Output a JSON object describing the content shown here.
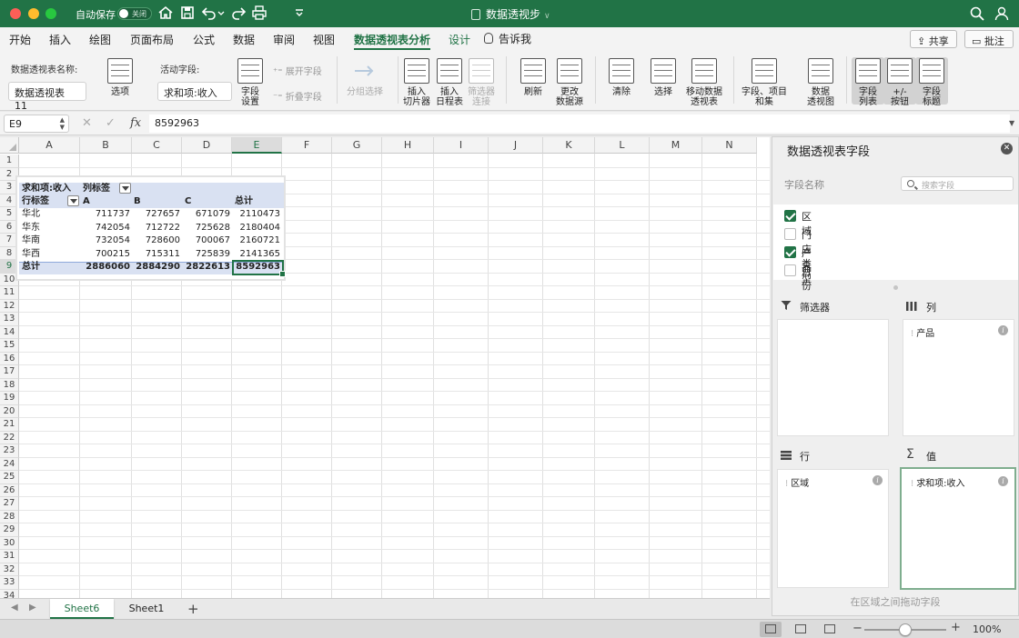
{
  "titlebar": {
    "autosave_label": "自动保存",
    "autosave_state": "关闭",
    "doc_title": "数据透视步",
    "title_chevron": "∨"
  },
  "menu": {
    "tabs": [
      "开始",
      "插入",
      "绘图",
      "页面布局",
      "公式",
      "数据",
      "审阅",
      "视图",
      "数据透视表分析",
      "设计"
    ],
    "active_tab": "数据透视表分析",
    "tell_me": "告诉我",
    "share": "共享",
    "comment": "批注"
  },
  "ribbon": {
    "pivot_name_label": "数据透视表名称:",
    "pivot_name": "数据透视表 11",
    "options": "选项",
    "active_field_label": "活动字段:",
    "active_field": "求和项:收入",
    "field_settings": [
      "字段",
      "设置"
    ],
    "expand_field": "展开字段",
    "collapse_field": "折叠字段",
    "group_selection": "分组选择",
    "insert_slicer": [
      "插入",
      "切片器"
    ],
    "insert_timeline": [
      "插入",
      "日程表"
    ],
    "filter_connections": [
      "筛选器",
      "连接"
    ],
    "refresh": "刷新",
    "change_source": [
      "更改",
      "数据源"
    ],
    "clear": "清除",
    "select": "选择",
    "move_pivot": [
      "移动数据",
      "透视表"
    ],
    "fields_items": [
      "字段、项目",
      "和集"
    ],
    "pivot_chart": [
      "数据",
      "透视图"
    ],
    "field_list": [
      "字段",
      "列表"
    ],
    "buttons": [
      "+/-",
      "按钮"
    ],
    "field_headers": [
      "字段",
      "标题"
    ]
  },
  "formula_bar": {
    "cell_ref": "E9",
    "fx": "fx",
    "value": "8592963"
  },
  "grid": {
    "columns": [
      "A",
      "B",
      "C",
      "D",
      "E",
      "F",
      "G",
      "H",
      "I",
      "J",
      "K",
      "L",
      "M",
      "N"
    ],
    "selected_column": "E",
    "rows": [
      "1",
      "2",
      "3",
      "4",
      "5",
      "6",
      "7",
      "8",
      "9",
      "10",
      "11",
      "12",
      "13",
      "14",
      "15",
      "16",
      "17",
      "18",
      "19",
      "20",
      "21",
      "22",
      "23",
      "24",
      "25",
      "26",
      "27",
      "28",
      "29",
      "30",
      "31",
      "32",
      "33",
      "34"
    ],
    "selected_row": "9"
  },
  "pivot": {
    "value_field": "求和项:收入",
    "col_labels": "列标签",
    "row_labels": "行标签",
    "col_headers": [
      "A",
      "B",
      "C",
      "总计"
    ],
    "rows": [
      {
        "label": "华北",
        "values": [
          "711737",
          "727657",
          "671079",
          "2110473"
        ]
      },
      {
        "label": "华东",
        "values": [
          "742054",
          "712722",
          "725628",
          "2180404"
        ]
      },
      {
        "label": "华南",
        "values": [
          "732054",
          "728600",
          "700067",
          "2160721"
        ]
      },
      {
        "label": "华西",
        "values": [
          "700215",
          "715311",
          "725839",
          "2141365"
        ]
      }
    ],
    "total": {
      "label": "总计",
      "values": [
        "2886060",
        "2884290",
        "2822613",
        "8592963"
      ]
    }
  },
  "sheets": {
    "tabs": [
      "Sheet6",
      "Sheet1"
    ],
    "active": "Sheet6",
    "add": "+"
  },
  "status": {
    "zoom": "100%",
    "zoom_fraction": 0.42
  },
  "field_panel": {
    "title": "数据透视表字段",
    "field_name_label": "字段名称",
    "search_placeholder": "搜索字段",
    "fields": [
      {
        "name": "区域",
        "checked": true
      },
      {
        "name": "门店类型",
        "checked": false
      },
      {
        "name": "产品",
        "checked": true
      },
      {
        "name": "月份",
        "checked": false
      }
    ],
    "areas": {
      "filters": {
        "title": "筛选器",
        "items": []
      },
      "columns": {
        "title": "列",
        "items": [
          "产品"
        ]
      },
      "rows": {
        "title": "行",
        "items": [
          "区域"
        ]
      },
      "values": {
        "title": "值",
        "items": [
          "求和项:收入"
        ]
      }
    },
    "drag_hint": "在区域之间拖动字段"
  },
  "colors": {
    "accent": "#217346",
    "pivot_header": "#d9e1f2"
  }
}
